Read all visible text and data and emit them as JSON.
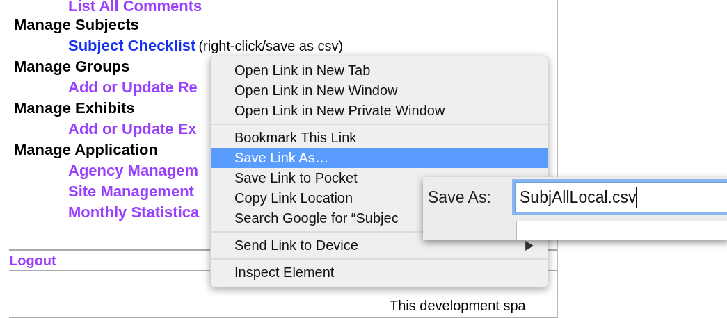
{
  "page": {
    "sections": [
      {
        "links": [
          {
            "text": "List All Comments",
            "visited": true
          }
        ]
      },
      {
        "heading": "Manage Subjects",
        "links": [
          {
            "text": "Subject Checklist",
            "visited": false,
            "note": "(right-click/save as csv)"
          }
        ]
      },
      {
        "heading": "Manage Groups",
        "links": [
          {
            "text": "Add or Update Re",
            "visited": true
          }
        ]
      },
      {
        "heading": "Manage Exhibits",
        "links": [
          {
            "text": "Add or Update Ex",
            "visited": true
          }
        ]
      },
      {
        "heading": "Manage Application",
        "links": [
          {
            "text": "Agency Managem",
            "visited": true
          },
          {
            "text": "Site Management",
            "visited": true
          },
          {
            "text": "Monthly Statistica",
            "visited": true
          }
        ]
      }
    ],
    "logout": {
      "text": "Logout",
      "visited": true
    },
    "footer_text": "This development spa"
  },
  "context_menu": {
    "groups": [
      [
        {
          "label": "Open Link in New Tab",
          "selected": false
        },
        {
          "label": "Open Link in New Window",
          "selected": false
        },
        {
          "label": "Open Link in New Private Window",
          "selected": false
        }
      ],
      [
        {
          "label": "Bookmark This Link",
          "selected": false
        },
        {
          "label": "Save Link As…",
          "selected": true
        },
        {
          "label": "Save Link to Pocket",
          "selected": false
        },
        {
          "label": "Copy Link Location",
          "selected": false
        },
        {
          "label": "Search Google for “Subjec",
          "selected": false
        }
      ],
      [
        {
          "label": "Send Link to Device",
          "selected": false,
          "submenu": true
        }
      ],
      [
        {
          "label": "Inspect Element",
          "selected": false
        }
      ]
    ]
  },
  "save_dialog": {
    "label": "Save As:",
    "filename": "SubjAllLocal.csv",
    "focused": true
  }
}
